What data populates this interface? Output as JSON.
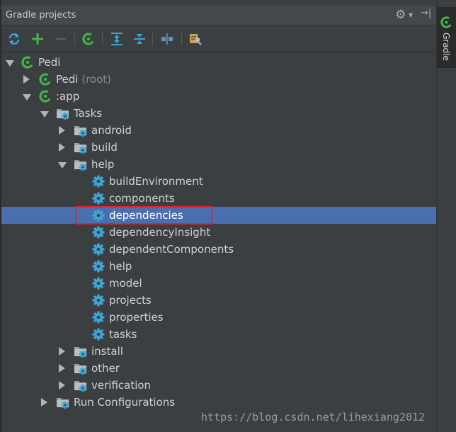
{
  "panel": {
    "title": "Gradle projects"
  },
  "stripe": {
    "tab_label": "Gradle"
  },
  "toolbar": {
    "icons": [
      "refresh-icon",
      "add-icon",
      "remove-icon",
      "gradle-execute-icon",
      "expand-all-icon",
      "collapse-all-icon",
      "link-icon",
      "settings-wrench-icon"
    ]
  },
  "tree": {
    "pedi": "Pedi",
    "pedi_root_name": "Pedi",
    "pedi_root_suffix": "(root)",
    "app": ":app",
    "tasks": "Tasks",
    "android": "android",
    "build": "build",
    "help": "help",
    "help_tasks": [
      "buildEnvironment",
      "components",
      "dependencies",
      "dependencyInsight",
      "dependentComponents",
      "help",
      "model",
      "projects",
      "properties",
      "tasks"
    ],
    "install": "install",
    "other": "other",
    "verification": "verification",
    "run_configurations": "Run Configurations"
  },
  "watermark": "https://blog.csdn.net/lihexiang2012",
  "colors": {
    "selection": "#4b6eaf",
    "highlight_box": "#e0242b",
    "gradle_green": "#3fb54a",
    "gear_blue": "#3ea5d8"
  }
}
